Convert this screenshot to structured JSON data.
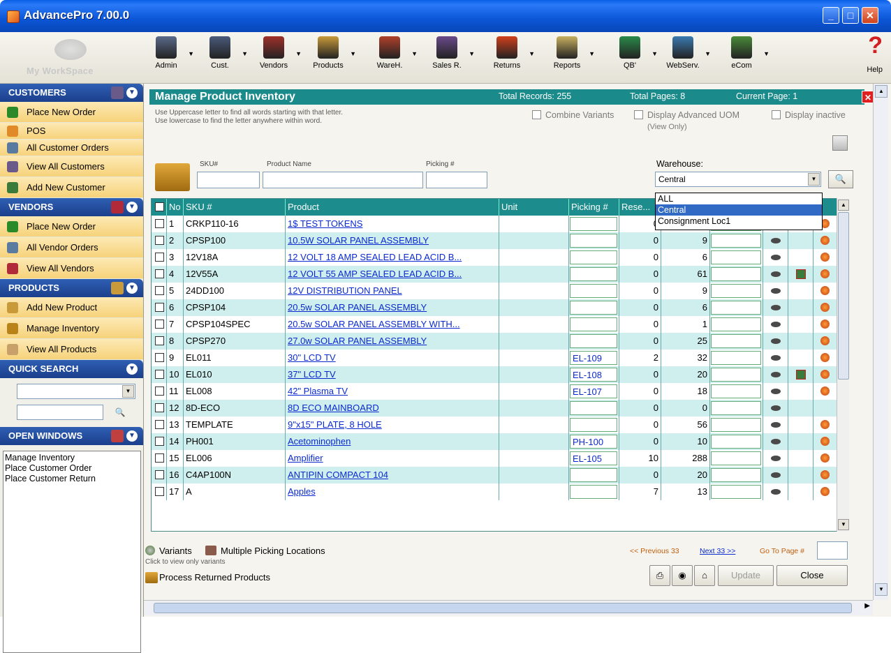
{
  "window": {
    "title": "AdvancePro 7.00.0"
  },
  "toolbar": {
    "workspace_label": "My WorkSpace",
    "buttons": [
      "Admin",
      "Cust.",
      "Vendors",
      "Products",
      "WareH.",
      "Sales R.",
      "Returns",
      "Reports",
      "QB'",
      "WebServ.",
      "eCom"
    ],
    "help_label": "Help"
  },
  "sidebar": {
    "customers": {
      "title": "CUSTOMERS",
      "items": [
        "Place New Order",
        "POS",
        "All Customer Orders",
        "View All Customers",
        "Add New Customer"
      ]
    },
    "vendors": {
      "title": "VENDORS",
      "items": [
        "Place New Order",
        "All Vendor Orders",
        "View All Vendors"
      ]
    },
    "products": {
      "title": "PRODUCTS",
      "items": [
        "Add New Product",
        "Manage Inventory",
        "View All Products"
      ]
    },
    "quick_search": {
      "title": "QUICK SEARCH"
    },
    "open_windows": {
      "title": "OPEN WINDOWS",
      "items": [
        "Manage Inventory",
        "Place Customer Order",
        "Place Customer Return"
      ]
    }
  },
  "main": {
    "title": "Manage Product Inventory",
    "total_records": "Total Records: 255",
    "total_pages": "Total Pages: 8",
    "current_page": "Current Page: 1",
    "hint1": "Use Uppercase letter to find all words starting with that letter.",
    "hint2": "Use lowercase to find the letter anywhere within word.",
    "combine_variants": "Combine Variants",
    "display_adv_uom": "Display Advanced UOM",
    "view_only": "(View Only)",
    "display_inactive": "Display inactive",
    "filters": {
      "sku_label": "SKU#",
      "product_label": "Product Name",
      "picking_label": "Picking #",
      "warehouse_label": "Warehouse:",
      "warehouse_value": "Central"
    },
    "warehouse_options": [
      "ALL",
      "Central",
      "Consignment Loc1"
    ],
    "columns": [
      "No",
      "SKU #",
      "Product",
      "Unit",
      "Picking #",
      "Rese..."
    ],
    "rows": [
      {
        "no": "1",
        "sku": "CRKP110-16",
        "product": "1$ TEST TOKENS",
        "pick": "",
        "res": "0",
        "qty": "",
        "loc": false,
        "act": true
      },
      {
        "no": "2",
        "sku": "CPSP100",
        "product": "10.5W SOLAR PANEL ASSEMBLY",
        "pick": "",
        "res": "0",
        "qty": "9",
        "loc": false,
        "act": true
      },
      {
        "no": "3",
        "sku": "12V18A",
        "product": "12 VOLT  18 AMP SEALED LEAD ACID  B...",
        "pick": "",
        "res": "0",
        "qty": "6",
        "loc": false,
        "act": true
      },
      {
        "no": "4",
        "sku": "12V55A",
        "product": "12 VOLT  55 AMP SEALED LEAD ACID  B...",
        "pick": "",
        "res": "0",
        "qty": "61",
        "loc": true,
        "act": true
      },
      {
        "no": "5",
        "sku": "24DD100",
        "product": "12V DISTRIBUTION PANEL",
        "pick": "",
        "res": "0",
        "qty": "9",
        "loc": false,
        "act": true
      },
      {
        "no": "6",
        "sku": "CPSP104",
        "product": "20.5w SOLAR PANEL ASSEMBLY",
        "pick": "",
        "res": "0",
        "qty": "6",
        "loc": false,
        "act": true
      },
      {
        "no": "7",
        "sku": "CPSP104SPEC",
        "product": "20.5w  SOLAR  PANEL ASSEMBLY  WITH...",
        "pick": "",
        "res": "0",
        "qty": "1",
        "loc": false,
        "act": true
      },
      {
        "no": "8",
        "sku": "CPSP270",
        "product": "27.0w SOLAR PANEL ASSEMBLY",
        "pick": "",
        "res": "0",
        "qty": "25",
        "loc": false,
        "act": true
      },
      {
        "no": "9",
        "sku": "EL011",
        "product": "30\" LCD TV",
        "pick": "EL-109",
        "res": "2",
        "qty": "32",
        "loc": false,
        "act": true
      },
      {
        "no": "10",
        "sku": "EL010",
        "product": "37\" LCD TV",
        "pick": "EL-108",
        "res": "0",
        "qty": "20",
        "loc": true,
        "act": true
      },
      {
        "no": "11",
        "sku": "EL008",
        "product": "42\" Plasma TV",
        "pick": "EL-107",
        "res": "0",
        "qty": "18",
        "loc": false,
        "act": true
      },
      {
        "no": "12",
        "sku": "8D-ECO",
        "product": "8D ECO MAINBOARD",
        "pick": "",
        "res": "0",
        "qty": "0",
        "loc": false,
        "act": false
      },
      {
        "no": "13",
        "sku": "TEMPLATE",
        "product": "9\"x15\" PLATE, 8 HOLE",
        "pick": "",
        "res": "0",
        "qty": "56",
        "loc": false,
        "act": true
      },
      {
        "no": "14",
        "sku": "PH001",
        "product": "Acetominophen",
        "pick": "PH-100",
        "res": "0",
        "qty": "10",
        "loc": false,
        "act": true
      },
      {
        "no": "15",
        "sku": "EL006",
        "product": "Amplifier",
        "pick": "EL-105",
        "res": "10",
        "qty": "288",
        "loc": false,
        "act": true
      },
      {
        "no": "16",
        "sku": "C4AP100N",
        "product": "ANTIPIN COMPACT 104",
        "pick": "",
        "res": "0",
        "qty": "20",
        "loc": false,
        "act": true
      },
      {
        "no": "17",
        "sku": "A",
        "product": "Apples",
        "pick": "",
        "res": "7",
        "qty": "13",
        "loc": false,
        "act": true
      }
    ],
    "footer": {
      "variants": "Variants",
      "multi_pick": "Multiple Picking Locations",
      "variants_hint": "Click to view only variants",
      "process_returned": "Process Returned Products",
      "prev": "<< Previous 33",
      "next": "Next 33 >>",
      "goto": "Go To Page #",
      "update": "Update",
      "close": "Close"
    }
  }
}
